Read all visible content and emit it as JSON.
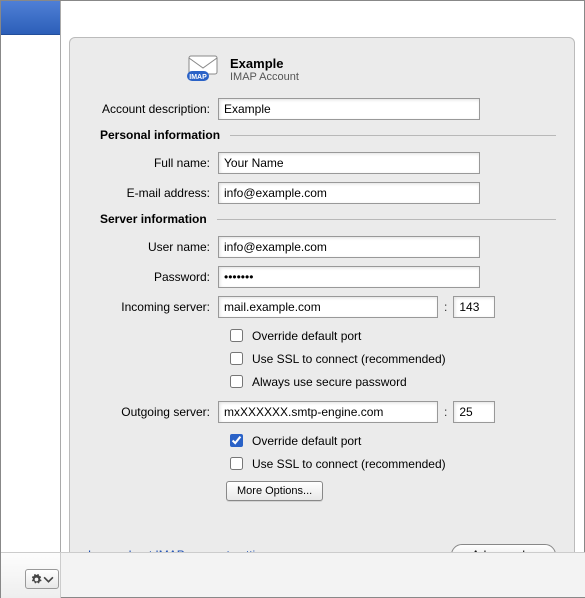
{
  "header": {
    "title": "Example",
    "subtitle": "IMAP Account"
  },
  "labels": {
    "account_description": "Account description:",
    "full_name": "Full name:",
    "email": "E-mail address:",
    "user_name": "User name:",
    "password": "Password:",
    "incoming": "Incoming server:",
    "outgoing": "Outgoing server:"
  },
  "sections": {
    "personal": "Personal information",
    "server": "Server information"
  },
  "values": {
    "account_description": "Example",
    "full_name": "Your Name",
    "email": "info@example.com",
    "user_name": "info@example.com",
    "password": "•••••••",
    "incoming_server": "mail.example.com",
    "incoming_port": "143",
    "outgoing_server": "mxXXXXXX.smtp-engine.com",
    "outgoing_port": "25"
  },
  "checkboxes": {
    "incoming_override": "Override default port",
    "incoming_ssl": "Use SSL to connect (recommended)",
    "incoming_secure_pw": "Always use secure password",
    "outgoing_override": "Override default port",
    "outgoing_ssl": "Use SSL to connect (recommended)"
  },
  "buttons": {
    "more_options": "More Options...",
    "advanced": "Advanced..."
  },
  "footer": {
    "link": "Learn about IMAP account settings"
  }
}
